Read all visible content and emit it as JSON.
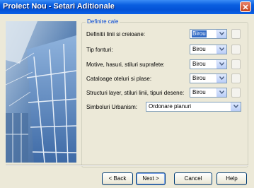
{
  "window": {
    "title": "Proiect Nou - Setari Aditionale"
  },
  "group": {
    "legend": "Definire cale"
  },
  "rows": [
    {
      "label": "Definitii linii si creioane:",
      "value": "Birou",
      "selected": true
    },
    {
      "label": "Tip fonturi:",
      "value": "Birou"
    },
    {
      "label": "Motive, hasuri, stiluri suprafete:",
      "value": "Birou"
    },
    {
      "label": "Cataloage oteluri si plase:",
      "value": "Birou"
    },
    {
      "label": "Structuri layer, stiluri linii, tipuri desene:",
      "value": "Birou"
    }
  ],
  "urbanism": {
    "label": "Simboluri Urbanism:",
    "value": "Ordonare planuri"
  },
  "buttons": {
    "back": "< Back",
    "next": "Next >",
    "cancel": "Cancel",
    "help": "Help"
  },
  "colors": {
    "titlebar": "#0a5fe0",
    "legend": "#0046d5",
    "selection": "#316ac5",
    "dialog_bg": "#ece9d8"
  }
}
